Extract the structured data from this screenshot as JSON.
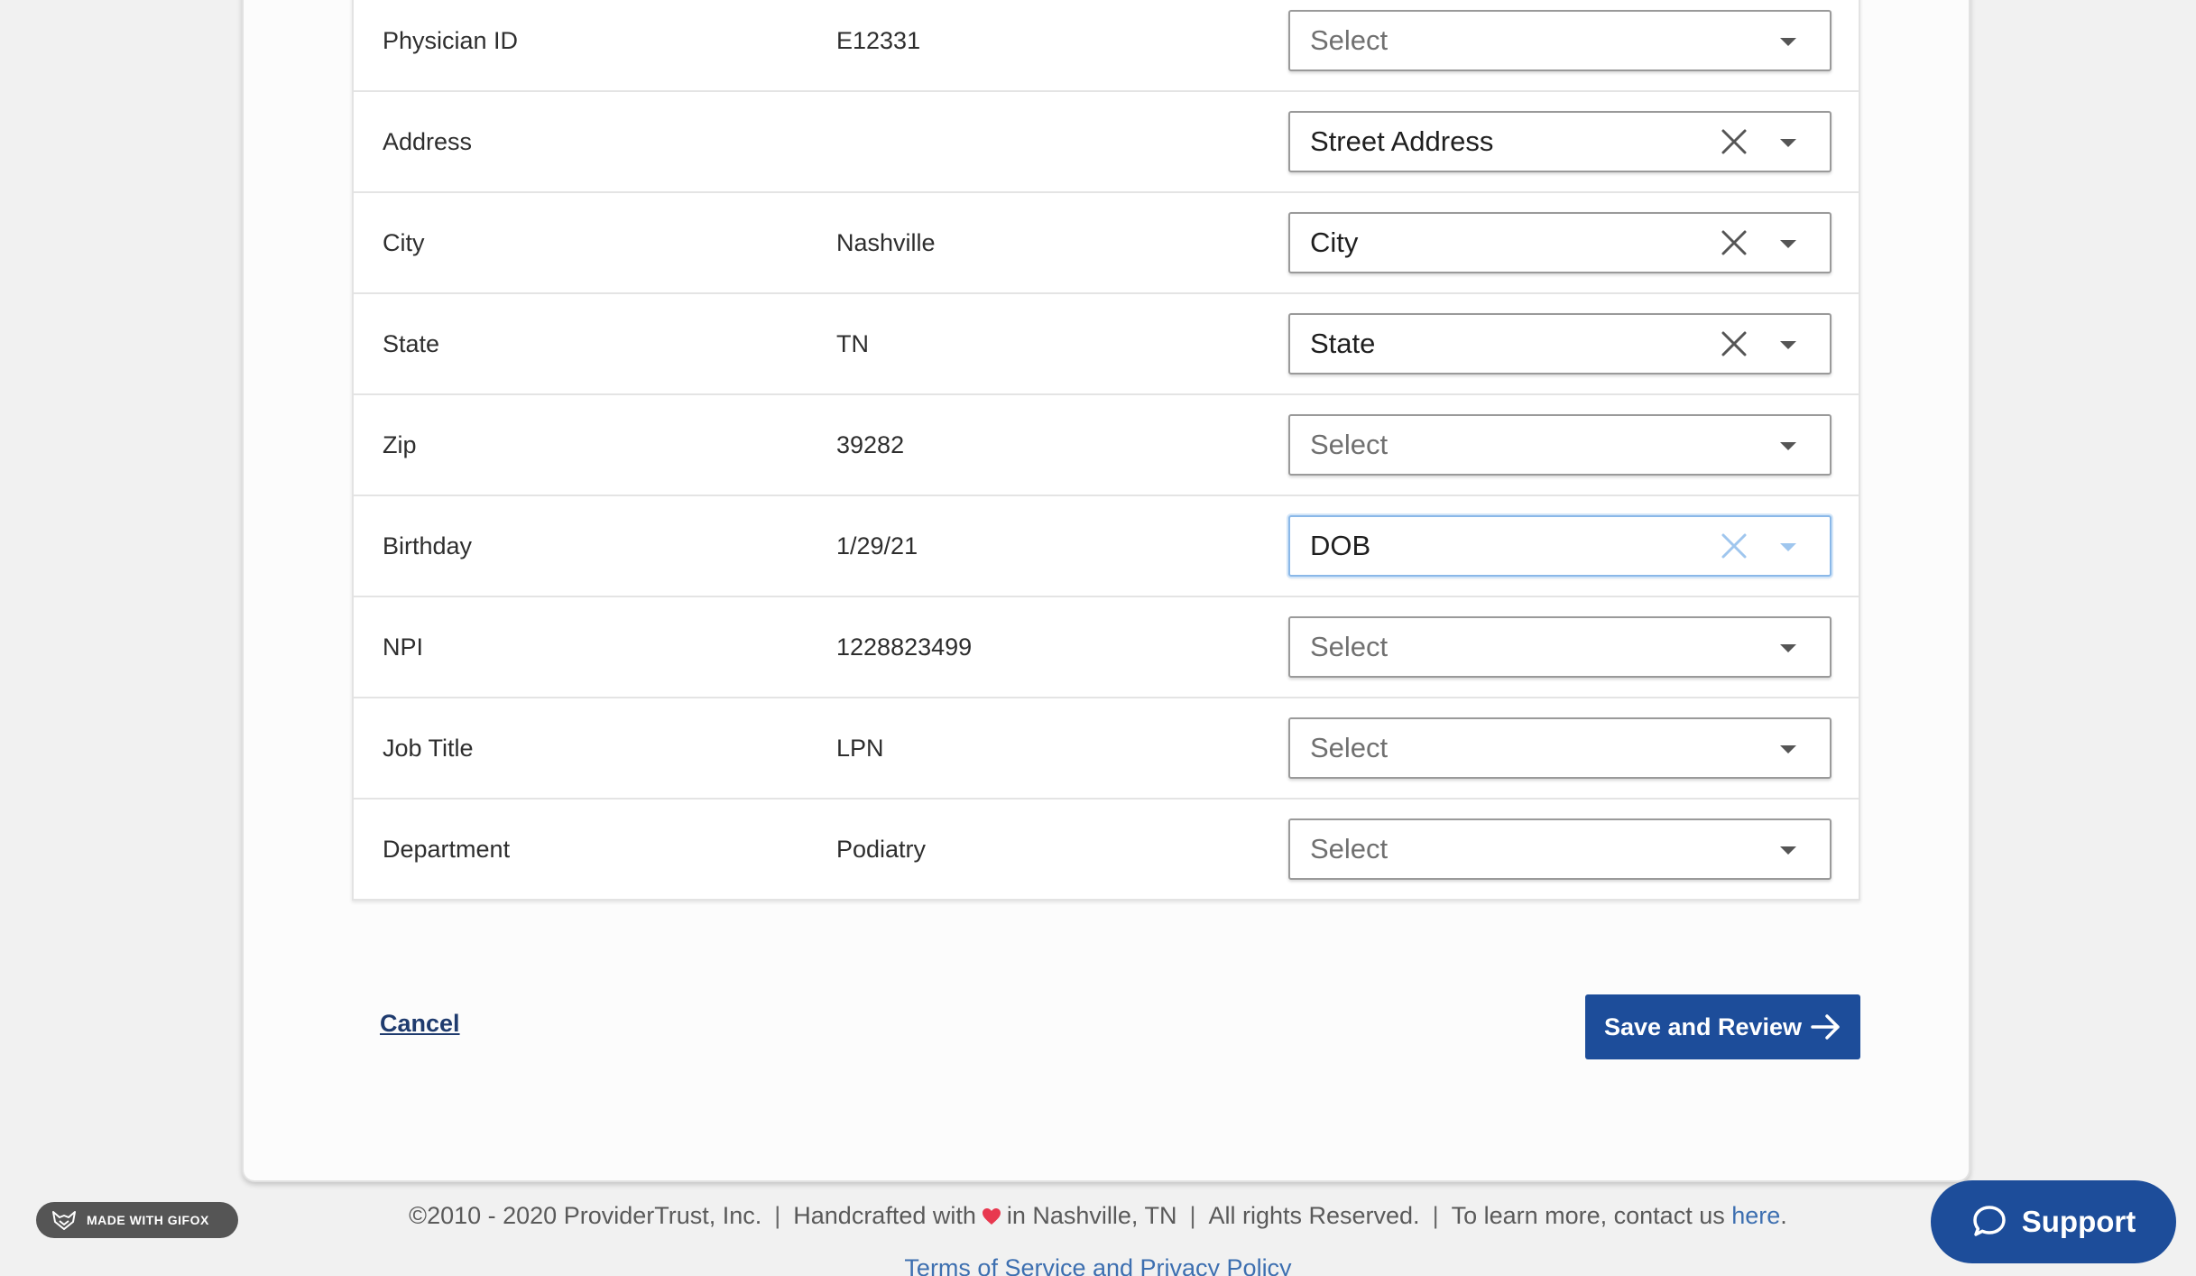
{
  "table": {
    "rows": [
      {
        "label": "Physician ID",
        "value": "E12331",
        "select": "Select",
        "filled": false
      },
      {
        "label": "Address",
        "value": "",
        "select": "Street Address",
        "filled": true
      },
      {
        "label": "City",
        "value": "Nashville",
        "select": "City",
        "filled": true
      },
      {
        "label": "State",
        "value": "TN",
        "select": "State",
        "filled": true
      },
      {
        "label": "Zip",
        "value": "39282",
        "select": "Select",
        "filled": false
      },
      {
        "label": "Birthday",
        "value": "1/29/21",
        "select": "DOB",
        "filled": true,
        "focused": true
      },
      {
        "label": "NPI",
        "value": "1228823499",
        "select": "Select",
        "filled": false
      },
      {
        "label": "Job Title",
        "value": "LPN",
        "select": "Select",
        "filled": false
      },
      {
        "label": "Department",
        "value": "Podiatry",
        "select": "Select",
        "filled": false
      }
    ]
  },
  "actions": {
    "cancel_label": "Cancel",
    "save_label": "Save and Review"
  },
  "footer": {
    "copyright": "©2010 - 2020 ProviderTrust, Inc.",
    "handcrafted_prefix": "Handcrafted with",
    "handcrafted_suffix": "in Nashville, TN",
    "rights": "All rights Reserved.",
    "contact_prefix": "To learn more, contact us",
    "contact_link": "here",
    "contact_suffix": ".",
    "terms": "Terms of Service and Privacy Policy"
  },
  "badge": {
    "text": "MADE WITH GIFOX"
  },
  "support": {
    "label": "Support"
  },
  "colors": {
    "primary": "#1d4d9a",
    "link": "#3d6fb0",
    "heart": "#e8384f",
    "focus": "#8ab8e8"
  }
}
